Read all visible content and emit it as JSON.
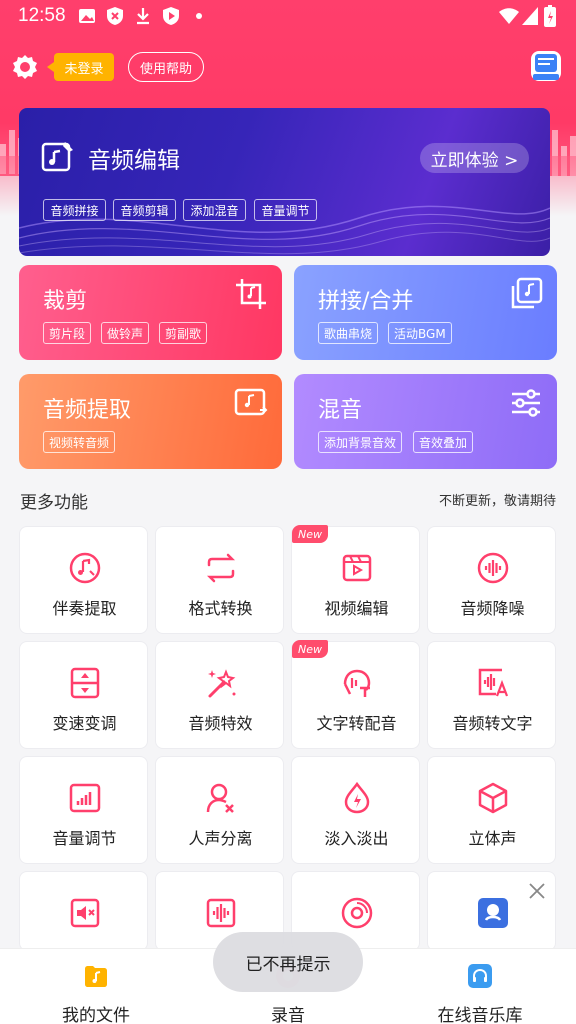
{
  "status": {
    "time": "12:58"
  },
  "header": {
    "login_label": "未登录",
    "help_label": "使用帮助"
  },
  "banner": {
    "title": "音频编辑",
    "cta": "立即体验 >",
    "tags": [
      "音频拼接",
      "音频剪辑",
      "添加混音",
      "音量调节"
    ]
  },
  "cards": [
    {
      "title": "裁剪",
      "tags": [
        "剪片段",
        "做铃声",
        "剪副歌"
      ]
    },
    {
      "title": "拼接/合并",
      "tags": [
        "歌曲串烧",
        "活动BGM"
      ]
    },
    {
      "title": "音频提取",
      "tags": [
        "视频转音频"
      ]
    },
    {
      "title": "混音",
      "tags": [
        "添加背景音效",
        "音效叠加"
      ]
    }
  ],
  "more": {
    "title": "更多功能",
    "subtitle": "不断更新，敬请期待"
  },
  "tiles": [
    {
      "label": "伴奏提取",
      "icon": "music-note-icon"
    },
    {
      "label": "格式转换",
      "icon": "repeat-icon"
    },
    {
      "label": "视频编辑",
      "icon": "video-edit-icon",
      "badge": "New"
    },
    {
      "label": "音频降噪",
      "icon": "soundwave-icon"
    },
    {
      "label": "变速变调",
      "icon": "speed-icon"
    },
    {
      "label": "音频特效",
      "icon": "magic-wand-icon"
    },
    {
      "label": "文字转配音",
      "icon": "tts-icon",
      "badge": "New"
    },
    {
      "label": "音频转文字",
      "icon": "audio-to-text-icon"
    },
    {
      "label": "音量调节",
      "icon": "volume-bars-icon"
    },
    {
      "label": "人声分离",
      "icon": "voice-separate-icon"
    },
    {
      "label": "淡入淡出",
      "icon": "fade-icon"
    },
    {
      "label": "立体声",
      "icon": "cube-icon"
    }
  ],
  "nav": {
    "files": "我的文件",
    "record": "录音",
    "library": "在线音乐库"
  },
  "toast": "已不再提示",
  "colors": {
    "brand": "#ff3f6c",
    "icon": "#ff3f6c"
  }
}
